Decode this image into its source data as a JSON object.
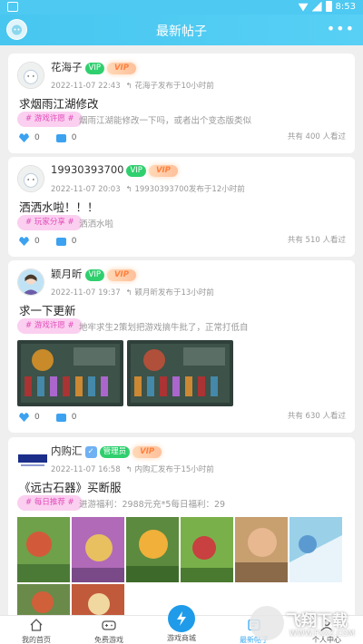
{
  "status_bar": {
    "time": "8:53"
  },
  "header": {
    "title": "最新帖子",
    "more_icon": "more-dots-icon"
  },
  "posts": [
    {
      "author": "花海子",
      "badges": [
        "VIP",
        "VIP"
      ],
      "date": "2022-11-07 22:43",
      "reply_text": "花海子发布于10小时前",
      "title": "求烟雨江湖修改",
      "tag": "# 游戏许愿 #",
      "excerpt": "烟雨江湖能修改一下吗，或者出个变态版类似",
      "likes": "0",
      "comments": "0",
      "views": "共有 400 人看过"
    },
    {
      "author": "19930393700",
      "badges": [
        "VIP",
        "VIP"
      ],
      "date": "2022-11-07 20:03",
      "reply_text": "19930393700发布于12小时前",
      "title": "洒洒水啦！！！",
      "tag": "# 玩家分享 #",
      "excerpt": "洒洒水啦",
      "likes": "0",
      "comments": "0",
      "views": "共有 510 人看过"
    },
    {
      "author": "颖月昕",
      "badges": [
        "VIP",
        "VIP"
      ],
      "date": "2022-11-07 19:37",
      "reply_text": "颖月昕发布于13小时前",
      "title": "求一下更新",
      "tag": "# 游戏许愿 #",
      "excerpt": "地牢求生2策划把游戏搞牛批了，正常打低自",
      "likes": "0",
      "comments": "0",
      "views": "共有 630 人看过"
    },
    {
      "author": "内购汇",
      "badges": [
        "管理员",
        "VIP"
      ],
      "date": "2022-11-07 16:58",
      "reply_text": "内购汇发布于15小时前",
      "title": "《远古石器》买断服",
      "tag": "# 每日推荐 #",
      "excerpt": "进游福利：2988元充*5每日福利：29"
    }
  ],
  "bottom_nav": [
    {
      "label": "我的首页",
      "icon": "home-icon"
    },
    {
      "label": "免费游戏",
      "icon": "gamepad-icon"
    },
    {
      "label": "游戏商城",
      "icon": "lightning-icon"
    },
    {
      "label": "最新帖子",
      "icon": "posts-icon"
    },
    {
      "label": "个人中心",
      "icon": "user-icon"
    }
  ],
  "watermark": {
    "text": "飞翔下载",
    "url": "WWW.FXXZ.COM"
  },
  "colors": {
    "accent": "#4dc9f2",
    "tag_bg": "#fbcff0",
    "tag_text": "#e24db9",
    "vip_green": "#2fcf6e",
    "icon_blue": "#3ca2f0"
  }
}
